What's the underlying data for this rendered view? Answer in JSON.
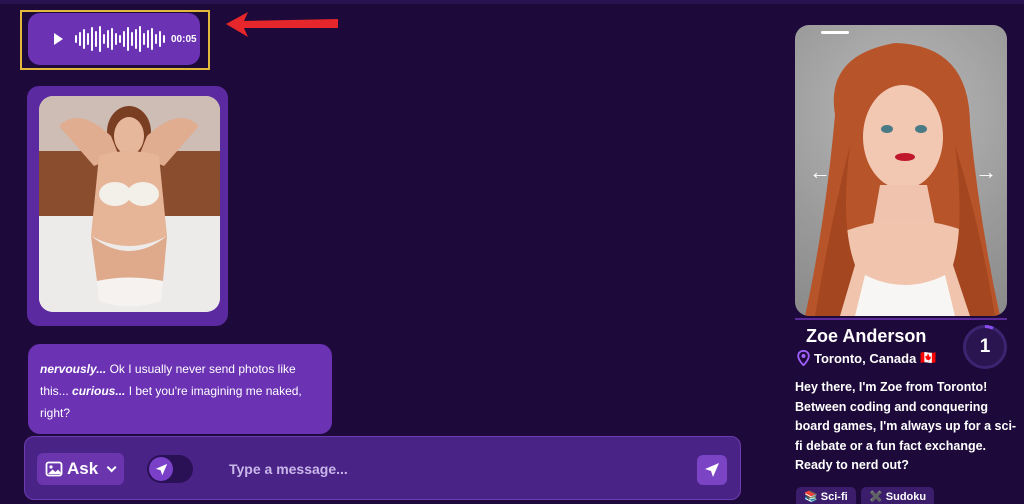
{
  "audio_message": {
    "duration": "00:05"
  },
  "text_message": {
    "segments": [
      {
        "text": "nervously...",
        "emphasis": true
      },
      {
        "text": " Ok I usually never send photos like this... ",
        "emphasis": false
      },
      {
        "text": "curious...",
        "emphasis": true
      },
      {
        "text": " I bet you're imagining me naked, right?",
        "emphasis": false
      }
    ]
  },
  "composer": {
    "mode_label": "Ask",
    "placeholder": "Type a message..."
  },
  "profile": {
    "name": "Zoe Anderson",
    "location": "Toronto, Canada",
    "flag": "🇨🇦",
    "level": "1",
    "bio": "Hey there, I'm Zoe from Toronto! Between coding and conquering board games, I'm always up for a sci-fi debate or a fun fact exchange. Ready to nerd out?",
    "tags": [
      {
        "emoji": "📚",
        "label": "Sci-fi"
      },
      {
        "emoji": "✖️",
        "label": "Sudoku"
      }
    ]
  },
  "colors": {
    "background": "#1d0a3a",
    "bubble": "#6b32b4",
    "highlight": "#e2b93b",
    "annotation_arrow": "#e5262b"
  }
}
